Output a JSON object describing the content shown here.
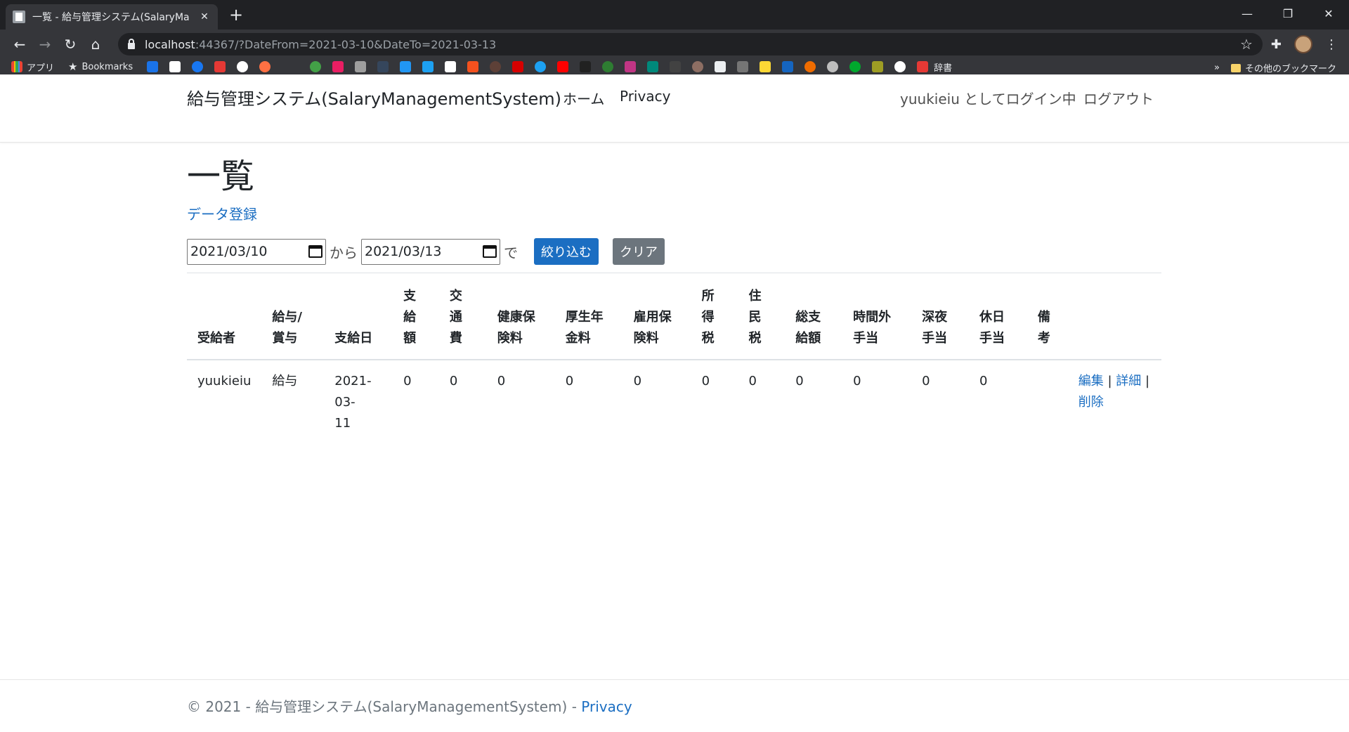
{
  "browser": {
    "tab_title": "一覧 - 給与管理システム(SalaryMa",
    "url_host": "localhost",
    "url_rest": ":44367/?DateFrom=2021-03-10&DateTo=2021-03-13",
    "bookmarks": {
      "apps_label": "アプリ",
      "bookmarks_label": "Bookmarks",
      "dict_label": "辞書",
      "other_label": "その他のブックマーク",
      "overflow_label": "»"
    }
  },
  "navbar": {
    "brand": "給与管理システム(SalaryManagementSystem)",
    "home": "ホーム",
    "privacy": "Privacy",
    "login_status": "yuukieiu としてログイン中",
    "logout": "ログアウト"
  },
  "main": {
    "title": "一覧",
    "create_link": "データ登録",
    "filter": {
      "date_from": "2021/03/10",
      "from_label": "から",
      "date_to": "2021/03/13",
      "to_label": "で",
      "filter_button": "絞り込む",
      "clear_button": "クリア"
    },
    "table": {
      "headers": [
        "受給者",
        "給与/賞与",
        "支給日",
        "支給額",
        "交通費",
        "健康保険料",
        "厚生年金料",
        "雇用保険料",
        "所得税",
        "住民税",
        "総支給額",
        "時間外手当",
        "深夜手当",
        "休日手当",
        "備考"
      ],
      "rows": [
        {
          "cells": [
            "yuukieiu",
            "給与",
            "2021-03-11",
            "0",
            "0",
            "0",
            "0",
            "0",
            "0",
            "0",
            "0",
            "0",
            "0",
            "0",
            ""
          ],
          "edit": "編集",
          "detail": "詳細",
          "delete": "削除"
        }
      ]
    }
  },
  "footer": {
    "text": "© 2021 - 給与管理システム(SalaryManagementSystem) - ",
    "privacy": "Privacy"
  },
  "colors": {
    "link": "#1b6ec2",
    "primary": "#1b6ec2",
    "secondary": "#6c757d",
    "chrome_dark": "#202124",
    "chrome_toolbar": "#35363a"
  }
}
